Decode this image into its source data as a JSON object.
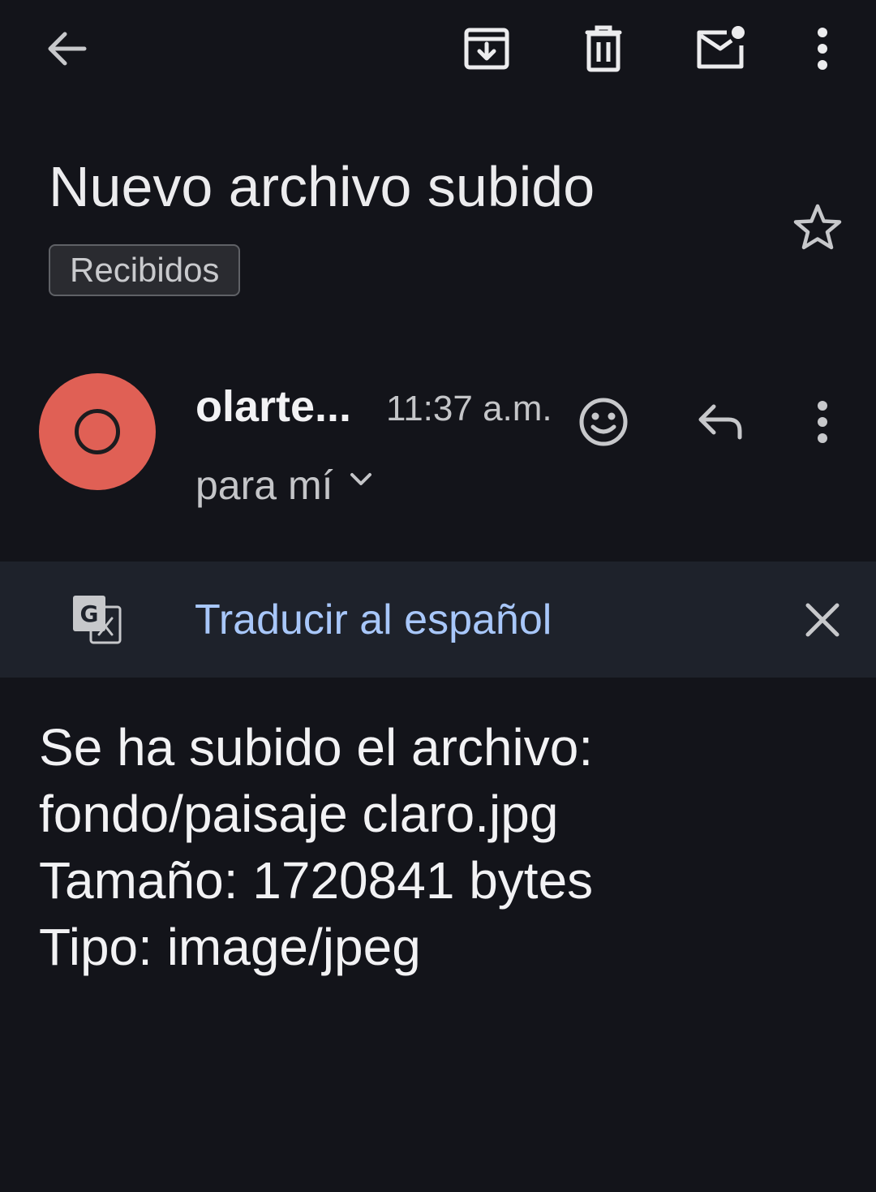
{
  "toolbar": {
    "back_icon": "arrow-back-icon",
    "archive_icon": "archive-icon",
    "delete_icon": "trash-icon",
    "mark_unread_icon": "mark-unread-icon",
    "more_icon": "more-vert-icon"
  },
  "email": {
    "subject": "Nuevo archivo subido",
    "label": "Recibidos",
    "sender": "olarte...",
    "avatar_letter": "O",
    "avatar_color": "#e06055",
    "time": "11:37 a.m.",
    "recipient": "para mí",
    "body_lines": [
      "Se ha subido el archivo:",
      "fondo/paisaje claro.jpg",
      "Tamaño: 1720841 bytes",
      "Tipo: image/jpeg"
    ]
  },
  "translate": {
    "link": "Traducir al español",
    "link_color": "#a8c7fa"
  },
  "colors": {
    "background": "#13141a",
    "translate_bar": "#1e222b"
  }
}
